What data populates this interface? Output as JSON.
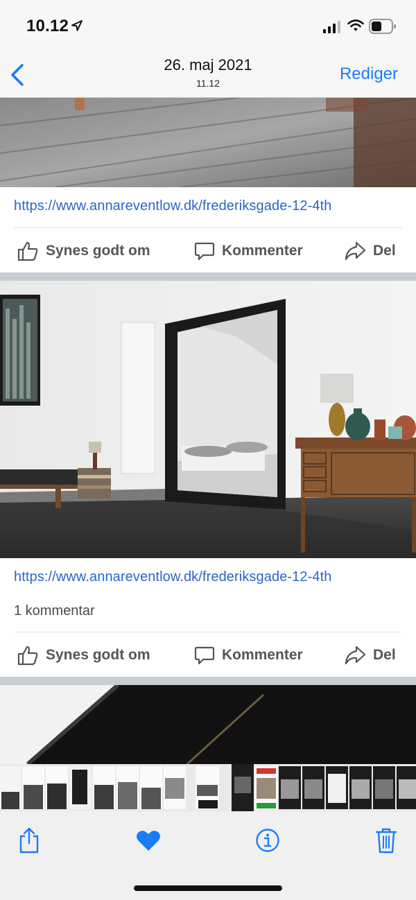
{
  "status_bar": {
    "time": "10.12"
  },
  "nav": {
    "title": "26. maj 2021",
    "subtitle": "11.12",
    "edit_label": "Rediger"
  },
  "posts": [
    {
      "link": "https://www.annareventlow.dk/frederiksgade-12-4th",
      "like_label": "Synes godt om",
      "comment_label": "Kommenter",
      "share_label": "Del"
    },
    {
      "link": "https://www.annareventlow.dk/frederiksgade-12-4th",
      "comment_count": "1 kommentar",
      "like_label": "Synes godt om",
      "comment_label": "Kommenter",
      "share_label": "Del"
    }
  ],
  "colors": {
    "accent": "#1a7cf5",
    "link": "#2a66c9",
    "action_text": "#555555"
  },
  "toolbar": {
    "icons": [
      "share-icon",
      "heart-icon",
      "info-icon",
      "trash-icon"
    ]
  }
}
